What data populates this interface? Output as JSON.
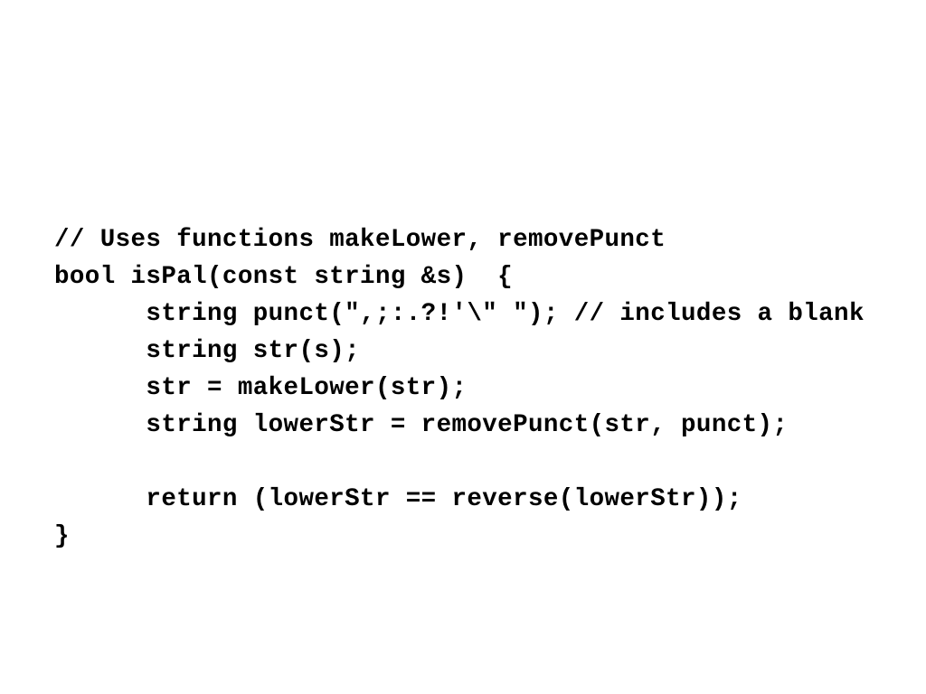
{
  "slide": {
    "background_color": "#ffffff",
    "text_color": "#000000",
    "code_listing": {
      "language": "cpp",
      "lines": [
        "// Uses functions makeLower, removePunct",
        "bool isPal(const string &s)  {",
        "      string punct(\",;:.?!'\\\" \"); // includes a blank",
        "      string str(s);",
        "      str = makeLower(str);",
        "      string lowerStr = removePunct(str, punct);",
        "",
        "      return (lowerStr == reverse(lowerStr));",
        "}"
      ]
    }
  }
}
